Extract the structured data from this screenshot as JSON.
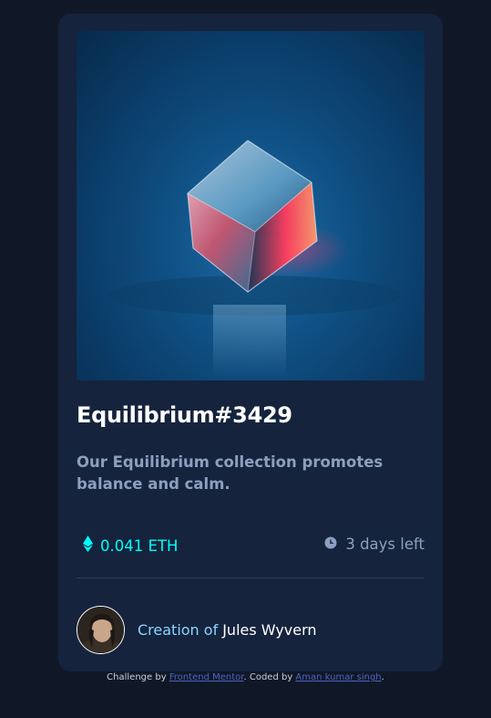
{
  "card": {
    "title": "Equilibrium#3429",
    "description": "Our Equilibrium collection promotes balance and calm.",
    "price": "0.041 ETH",
    "time_left": "3 days left",
    "creator_prefix": "Creation of",
    "creator_name": "Jules Wyvern"
  },
  "attribution": {
    "challenge_prefix": "Challenge by",
    "challenge_link": "Frontend Mentor",
    "coded_prefix": ". Coded by",
    "coder_link": "Aman kumar singh",
    "suffix": "."
  },
  "icons": {
    "price": "ethereum-icon",
    "time": "clock-icon"
  },
  "colors": {
    "background": "#101828",
    "card": "#15233d",
    "accent": "#00fff8",
    "muted": "#8ba0c0"
  }
}
